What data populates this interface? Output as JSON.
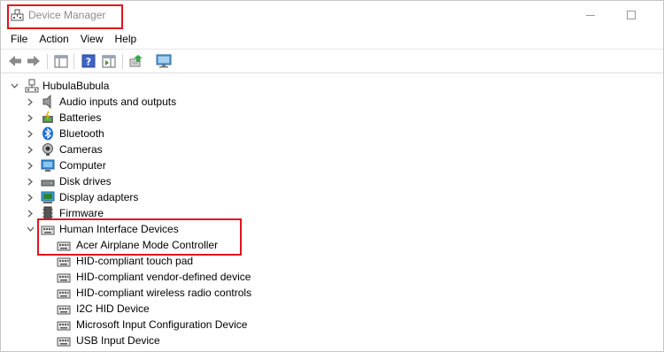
{
  "window": {
    "title": "Device Manager"
  },
  "menu": [
    "File",
    "Action",
    "View",
    "Help"
  ],
  "toolbar": {
    "buttons": [
      "back-icon",
      "forward-icon",
      "properties-icon",
      "help-icon",
      "action-pane-icon",
      "update-driver-icon",
      "scan-hardware-icon"
    ]
  },
  "tree": {
    "root": "HubulaBubula",
    "categories": [
      {
        "label": "Audio inputs and outputs",
        "icon": "speaker-icon"
      },
      {
        "label": "Batteries",
        "icon": "battery-icon"
      },
      {
        "label": "Bluetooth",
        "icon": "bluetooth-icon"
      },
      {
        "label": "Cameras",
        "icon": "camera-icon"
      },
      {
        "label": "Computer",
        "icon": "computer-icon"
      },
      {
        "label": "Disk drives",
        "icon": "disk-drive-icon"
      },
      {
        "label": "Display adapters",
        "icon": "display-adapter-icon"
      },
      {
        "label": "Firmware",
        "icon": "firmware-icon"
      },
      {
        "label": "Human Interface Devices",
        "icon": "hid-icon"
      }
    ],
    "hid_children": [
      "Acer Airplane Mode Controller",
      "HID-compliant touch pad",
      "HID-compliant vendor-defined device",
      "HID-compliant wireless radio controls",
      "I2C HID Device",
      "Microsoft Input Configuration Device",
      "USB Input Device"
    ]
  },
  "colors": {
    "highlight": "#e0141e",
    "title_text": "#8c8c8c"
  }
}
